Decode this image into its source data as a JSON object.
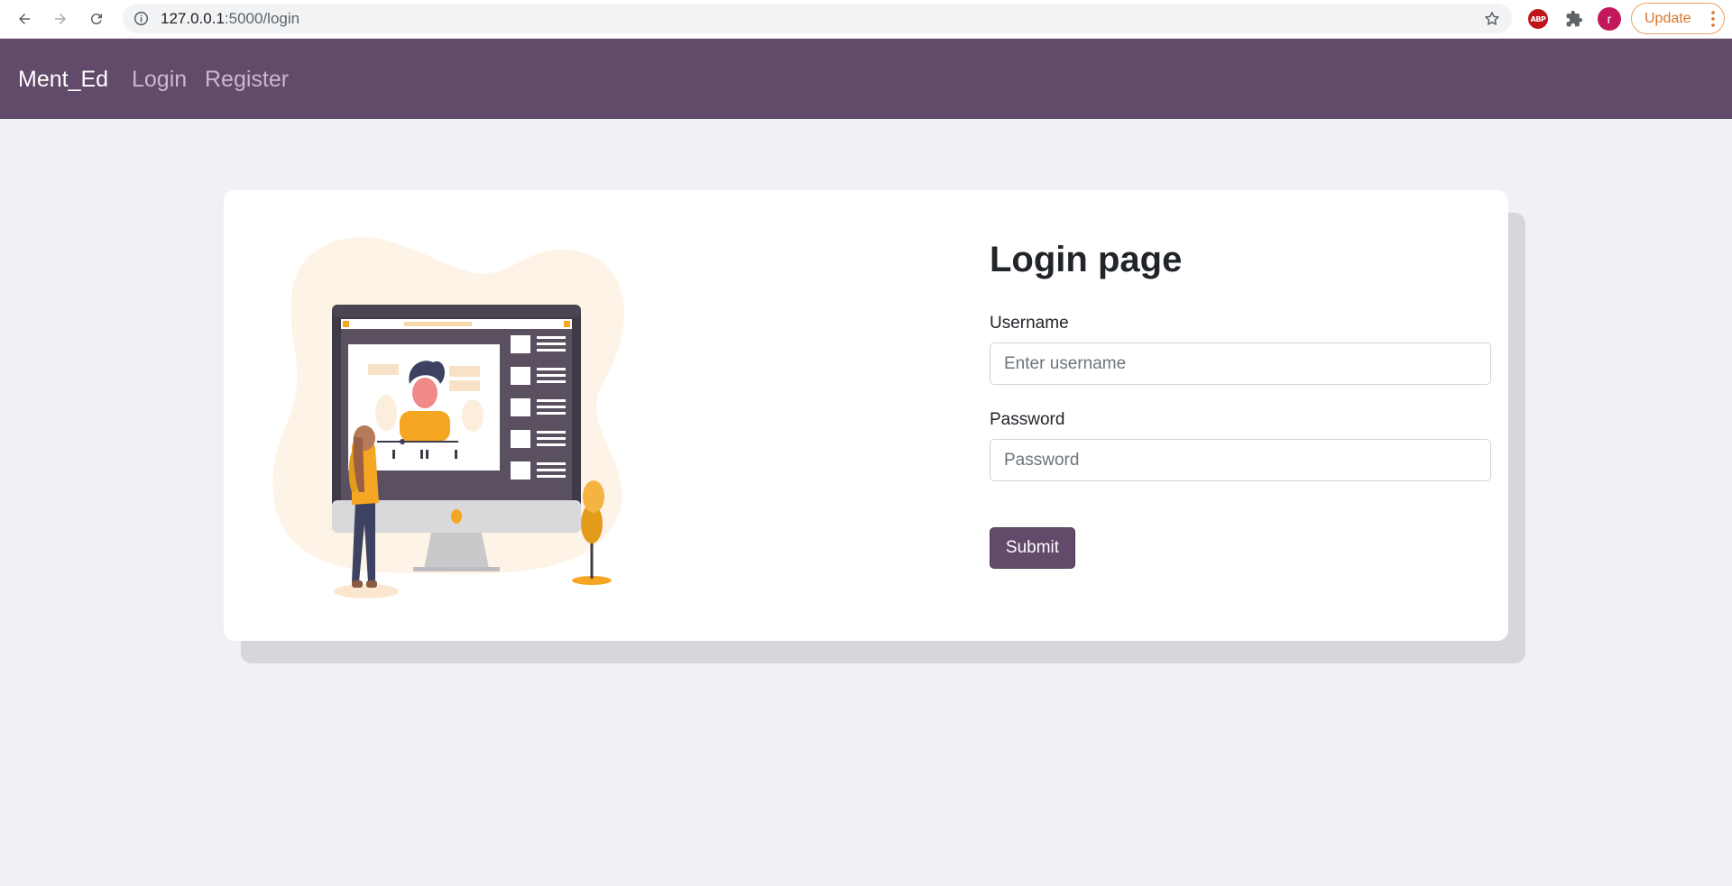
{
  "browser": {
    "url_host": "127.0.0.1",
    "url_path": ":5000/login",
    "update_label": "Update",
    "abp_label": "ABP",
    "avatar_letter": "r"
  },
  "navbar": {
    "brand": "Ment_Ed",
    "links": [
      "Login",
      "Register"
    ]
  },
  "form": {
    "title": "Login page",
    "username_label": "Username",
    "username_placeholder": "Enter username",
    "username_value": "",
    "password_label": "Password",
    "password_placeholder": "Password",
    "password_value": "",
    "submit_label": "Submit"
  },
  "colors": {
    "navbar": "#624a6a",
    "button": "#624a6a",
    "page_bg": "#f0f1f5",
    "illustration_accent": "#f5a623"
  }
}
